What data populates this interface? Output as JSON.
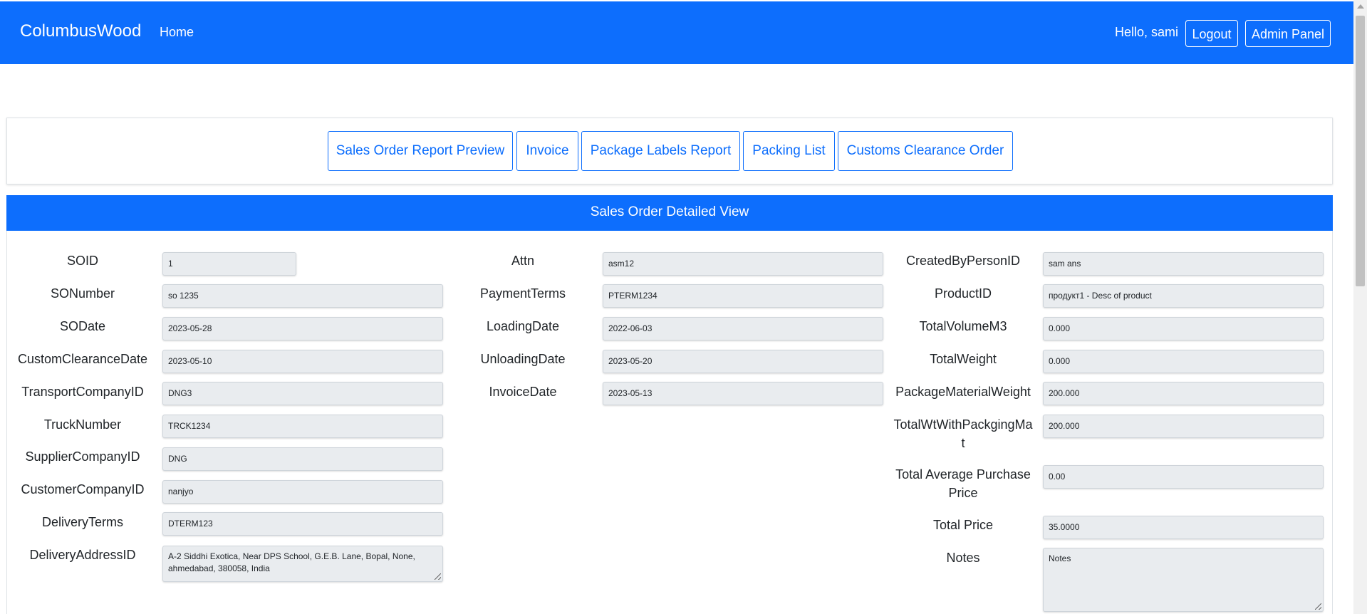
{
  "navbar": {
    "brand": "ColumbusWood",
    "home": "Home",
    "greeting": "Hello, sami",
    "logout": "Logout",
    "admin_panel": "Admin Panel"
  },
  "reports": {
    "sales_order_report_preview": "Sales Order Report Preview",
    "invoice": "Invoice",
    "package_labels_report": "Package Labels Report",
    "packing_list": "Packing List",
    "customs_clearance_order": "Customs Clearance Order"
  },
  "card": {
    "title": "Sales Order Detailed View"
  },
  "col1": {
    "soid": {
      "label": "SOID",
      "value": "1"
    },
    "sonumber": {
      "label": "SONumber",
      "value": "so 1235"
    },
    "sodate": {
      "label": "SODate",
      "value": "2023-05-28"
    },
    "customclearancedate": {
      "label": "CustomClearanceDate",
      "value": "2023-05-10"
    },
    "transportcompanyid": {
      "label": "TransportCompanyID",
      "value": "DNG3"
    },
    "trucknumber": {
      "label": "TruckNumber",
      "value": "TRCK1234"
    },
    "suppliercompanyid": {
      "label": "SupplierCompanyID",
      "value": "DNG"
    },
    "customercompanyid": {
      "label": "CustomerCompanyID",
      "value": "nanjyo"
    },
    "deliveryterms": {
      "label": "DeliveryTerms",
      "value": "DTERM123"
    },
    "deliveryaddressid": {
      "label": "DeliveryAddressID",
      "value": "A-2 Siddhi Exotica, Near DPS School, G.E.B. Lane, Bopal, None, ahmedabad, 380058, India"
    }
  },
  "col2": {
    "attn": {
      "label": "Attn",
      "value": "asm12"
    },
    "paymentterms": {
      "label": "PaymentTerms",
      "value": "PTERM1234"
    },
    "loadingdate": {
      "label": "LoadingDate",
      "value": "2022-06-03"
    },
    "unloadingdate": {
      "label": "UnloadingDate",
      "value": "2023-05-20"
    },
    "invoicedate": {
      "label": "InvoiceDate",
      "value": "2023-05-13"
    }
  },
  "col3": {
    "createdbypersonid": {
      "label": "CreatedByPersonID",
      "value": "sam ans"
    },
    "productid": {
      "label": "ProductID",
      "value": "продукт1 - Desc of product"
    },
    "totalvolumem3": {
      "label": "TotalVolumeM3",
      "value": "0.000"
    },
    "totalweight": {
      "label": "TotalWeight",
      "value": "0.000"
    },
    "packagematerialweight": {
      "label": "PackageMaterialWeight",
      "value": "200.000"
    },
    "totalwtwithpackgingmat": {
      "label": "TotalWtWithPackgingMat",
      "value": "200.000"
    },
    "totalaveragepurchaseprice": {
      "label": "Total Average Purchase Price",
      "value": "0.00"
    },
    "totalprice": {
      "label": "Total Price",
      "value": "35.0000"
    },
    "notes": {
      "label": "Notes",
      "value": "Notes"
    }
  }
}
